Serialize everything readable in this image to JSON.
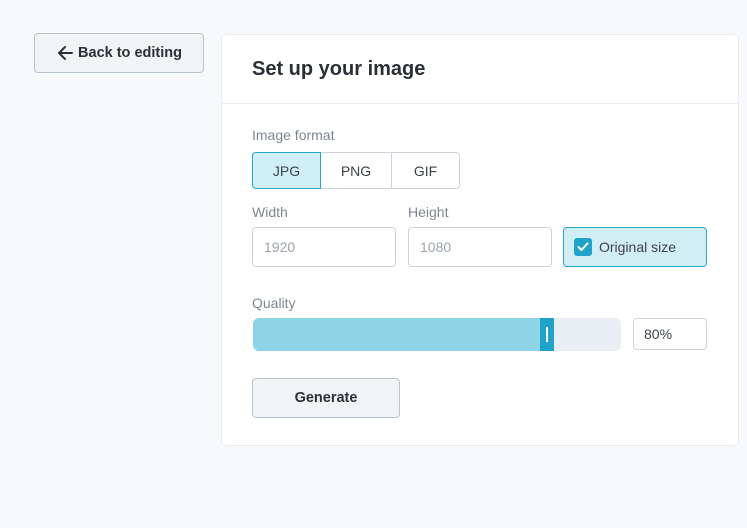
{
  "back_button": {
    "label": "Back to editing",
    "icon": "arrow-left-icon"
  },
  "panel": {
    "title": "Set up your image"
  },
  "format": {
    "label": "Image format",
    "options": [
      "JPG",
      "PNG",
      "GIF"
    ],
    "selected": "JPG"
  },
  "size": {
    "width_label": "Width",
    "width_placeholder": "1920",
    "height_label": "Height",
    "height_placeholder": "1080",
    "original_size_label": "Original size",
    "original_size_checked": true
  },
  "quality": {
    "label": "Quality",
    "value_percent": 80,
    "display": "80%"
  },
  "generate_button": {
    "label": "Generate"
  },
  "colors": {
    "accent": "#1fa3cb",
    "accent_light": "#cfeef6",
    "slider_fill": "#8fd4e6",
    "slider_track": "#e9edf4",
    "page_background": "#f8f9fa"
  }
}
